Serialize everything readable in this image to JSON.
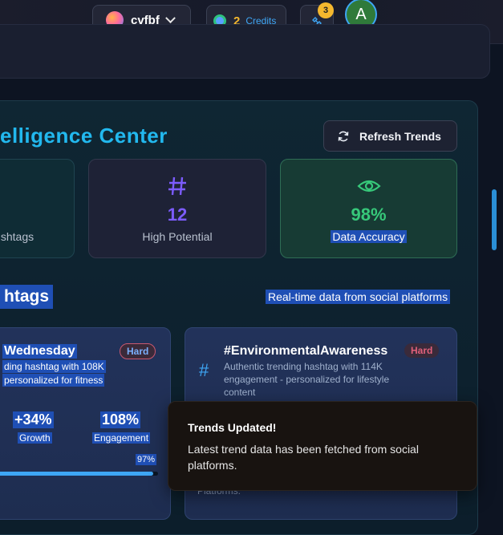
{
  "header": {
    "username": "cvfbf",
    "credits_count": "2",
    "credits_label": "Credits",
    "notifications_count": "3",
    "avatar_initial": "A"
  },
  "center": {
    "title": "elligence Center",
    "refresh_label": "Refresh Trends"
  },
  "stats": [
    {
      "value": "",
      "label": "shtags"
    },
    {
      "value": "12",
      "label": "High Potential",
      "color": "#7c5cff"
    },
    {
      "value": "98%",
      "label": "Data Accuracy",
      "color": "#37c97a"
    }
  ],
  "section": {
    "title": "htags",
    "subtitle": "Real-time data from social platforms"
  },
  "cards": [
    {
      "title": "Wednesday",
      "difficulty": "Hard",
      "desc_line1": "ding hashtag with 108K",
      "desc_line2": "personalized for fitness",
      "growth_value": "+34%",
      "growth_label": "Growth",
      "engagement_value": "108%",
      "engagement_label": "Engagement",
      "progress_label": "97%",
      "progress": 0.97
    },
    {
      "title": "#EnvironmentalAwareness",
      "difficulty": "Hard",
      "desc_line1": "Authentic trending hashtag with 114K",
      "desc_line2": "engagement - personalized for lifestyle",
      "desc_line3": "content"
    }
  ],
  "toast": {
    "title": "Trends Updated!",
    "message": "Latest trend data has been fetched from social platforms.",
    "behind_text": "Platforms."
  },
  "colors": {
    "accent": "#22b8ee",
    "hard_badge": "#e0607a"
  }
}
